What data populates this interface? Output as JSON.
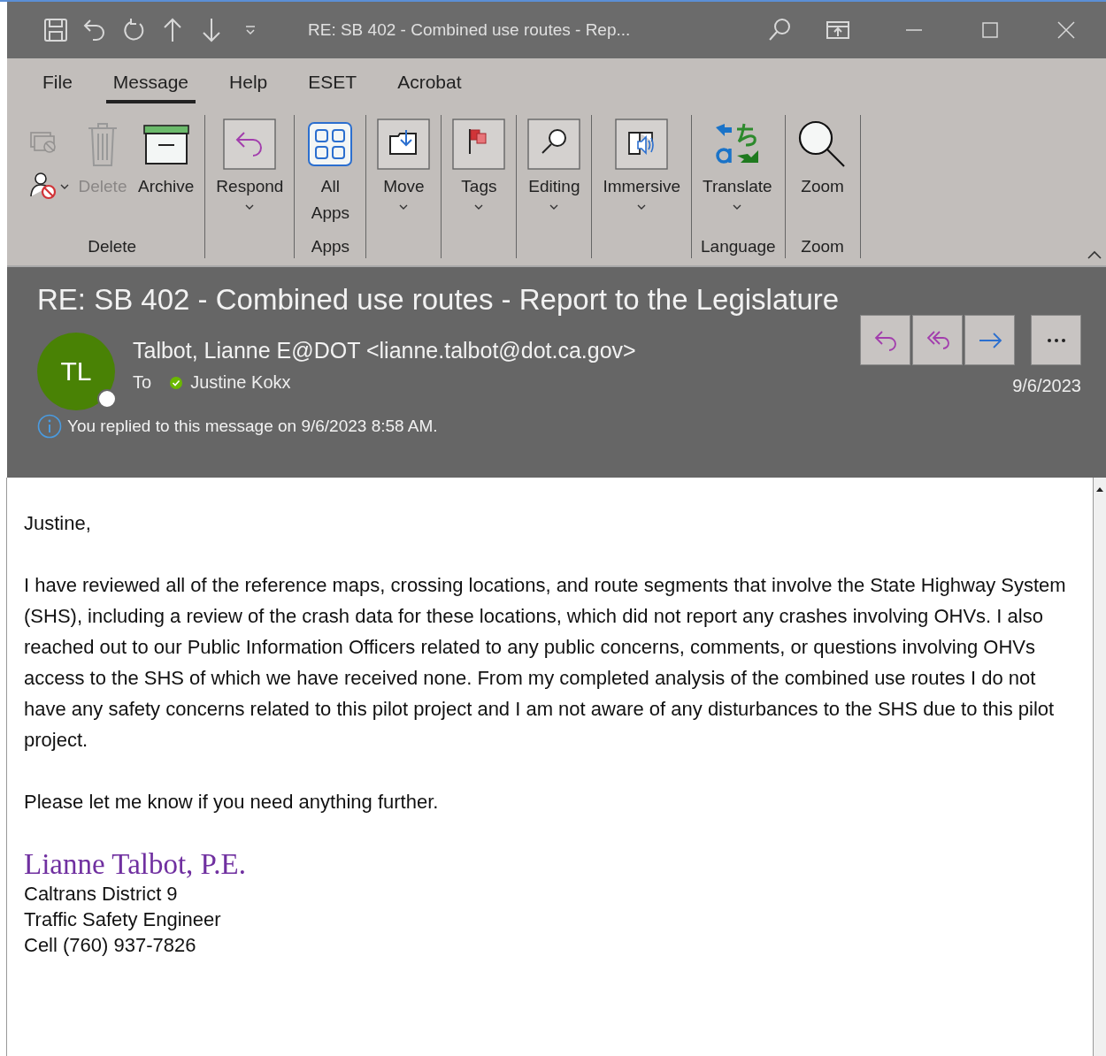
{
  "window": {
    "title": "RE: SB 402 - Combined use routes - Rep..."
  },
  "quick_access": [
    {
      "kind": "save"
    },
    {
      "kind": "undo"
    },
    {
      "kind": "redo"
    },
    {
      "kind": "up"
    },
    {
      "kind": "down"
    },
    {
      "kind": "customize"
    }
  ],
  "menu_tabs": [
    {
      "label": "File",
      "selected": false
    },
    {
      "label": "Message",
      "selected": true
    },
    {
      "label": "Help",
      "selected": false
    },
    {
      "label": "ESET",
      "selected": false
    },
    {
      "label": "Acrobat",
      "selected": false
    }
  ],
  "ribbon": {
    "groups": [
      {
        "label": "Delete",
        "small_buttons": [
          {
            "kind": "ignore",
            "disabled": true,
            "dropdown": false
          },
          {
            "kind": "block",
            "disabled": false,
            "dropdown": true
          }
        ],
        "buttons": [
          {
            "kind": "trash",
            "label": "Delete",
            "disabled": true,
            "dropdown": false
          },
          {
            "kind": "archive",
            "label": "Archive",
            "disabled": false,
            "dropdown": false
          }
        ]
      },
      {
        "buttons": [
          {
            "kind": "respond",
            "label": "Respond",
            "disabled": false,
            "dropdown": true
          }
        ]
      },
      {
        "label": "Apps",
        "buttons": [
          {
            "kind": "apps",
            "label": "All Apps",
            "disabled": false,
            "dropdown": false
          }
        ]
      },
      {
        "buttons": [
          {
            "kind": "move",
            "label": "Move",
            "disabled": false,
            "dropdown": true
          }
        ]
      },
      {
        "buttons": [
          {
            "kind": "tags",
            "label": "Tags",
            "disabled": false,
            "dropdown": true
          }
        ]
      },
      {
        "buttons": [
          {
            "kind": "editing",
            "label": "Editing",
            "disabled": false,
            "dropdown": true
          }
        ]
      },
      {
        "buttons": [
          {
            "kind": "immersive",
            "label": "Immersive",
            "disabled": false,
            "dropdown": true
          }
        ]
      },
      {
        "label": "Language",
        "buttons": [
          {
            "kind": "translate",
            "label": "Translate",
            "disabled": false,
            "dropdown": true
          }
        ]
      },
      {
        "label": "Zoom",
        "buttons": [
          {
            "kind": "zoom",
            "label": "Zoom",
            "disabled": false,
            "dropdown": false
          }
        ]
      }
    ]
  },
  "message": {
    "subject": "RE: SB 402 - Combined use routes - Report to the Legislature",
    "avatar_initials": "TL",
    "sender": "Talbot, Lianne E@DOT <lianne.talbot@dot.ca.gov>",
    "to_label": "To",
    "recipients": [
      {
        "name": "Justine Kokx"
      }
    ],
    "actions": [
      {
        "kind": "reply"
      },
      {
        "kind": "reply-all"
      },
      {
        "kind": "forward"
      },
      {
        "kind": "more"
      }
    ],
    "date": "9/6/2023",
    "info": "You replied to this message on 9/6/2023 8:58 AM."
  },
  "body": {
    "paragraphs": [
      "Justine,",
      "I have reviewed all of the reference maps, crossing locations, and route segments that involve the State Highway System (SHS), including a review of the crash data for these locations, which did not report any crashes involving OHVs.  I also reached out to our Public Information Officers related to any public concerns, comments, or questions involving OHVs access to the SHS of which we have received none.  From my completed analysis of the combined use routes I do not have any safety concerns related to this pilot project and I am not aware of any disturbances to the SHS due to this pilot project.",
      "Please let me know if you need anything further."
    ],
    "signature": {
      "name": "Lianne Talbot, P.E.",
      "lines": [
        "Caltrans District 9",
        "Traffic Safety Engineer",
        "Cell (760) 937-7826"
      ]
    }
  }
}
